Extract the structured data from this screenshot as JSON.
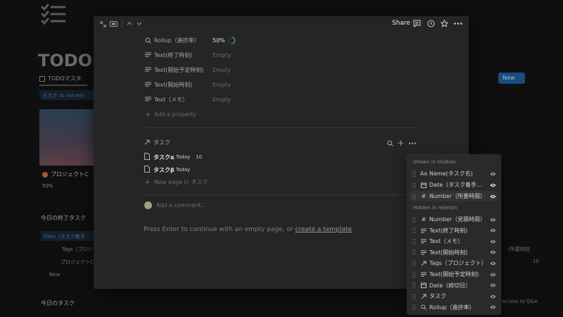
{
  "background": {
    "page_title": "TODOリ",
    "tab_label": "TODOマスタ",
    "filter_chip": "タスク: Is not em",
    "card_title": "プロジェクトC",
    "card_pct": "50%",
    "section1": "今日の終了タスク",
    "section1_link": "Date（タスク着手",
    "tags_text": "Tags（プロジ",
    "project_row": "プロジェクトC",
    "new_text": "New",
    "section2": "今日のタスク",
    "new_button": "New",
    "right_text1": "(所要時間",
    "right_text2": "10",
    "right_text3": "t access to Q&A"
  },
  "modal": {
    "share_label": "Share",
    "properties": [
      {
        "icon": "search-icon",
        "name": "Rollup（進捗率）",
        "value": "50%",
        "strong": true
      },
      {
        "icon": "text-lines-icon",
        "name": "Text(終了時刻)",
        "value": "Empty"
      },
      {
        "icon": "text-lines-icon",
        "name": "Text(開始予定時刻)",
        "value": "Empty"
      },
      {
        "icon": "text-lines-icon",
        "name": "Text(開始時刻)",
        "value": "Empty"
      },
      {
        "icon": "text-lines-icon",
        "name": "Text（メモ）",
        "value": "Empty"
      }
    ],
    "add_property": "Add a property",
    "relation_title": "タスク",
    "tasks": [
      {
        "name": "タスクα",
        "date": "Today",
        "num": "10"
      },
      {
        "name": "タスクβ",
        "date": "Today",
        "num": ""
      }
    ],
    "new_page": "New page in タスク",
    "comment_placeholder": "Add a comment...",
    "enter_text": "Press Enter to continue with an empty page, or ",
    "enter_link": "create a template",
    "progress_fraction": 0.5
  },
  "popup": {
    "shown_heading": "Shown in relation",
    "hidden_heading": "Hidden in relation",
    "shown": [
      {
        "icon": "Aa",
        "label": "Name(タスク名)",
        "visible": true
      },
      {
        "icon": "calendar",
        "label": "Date（タスク着手日）",
        "visible": true
      },
      {
        "icon": "#",
        "label": "Number（所要時間）",
        "visible": true,
        "active": true
      }
    ],
    "hidden": [
      {
        "icon": "#",
        "label": "Number（見積時間）"
      },
      {
        "icon": "lines",
        "label": "Text(終了時刻)"
      },
      {
        "icon": "lines",
        "label": "Text（メモ）"
      },
      {
        "icon": "lines",
        "label": "Text(開始時刻)"
      },
      {
        "icon": "arrow",
        "label": "Tags（プロジェクト）"
      },
      {
        "icon": "lines",
        "label": "Text(開始予定時刻)"
      },
      {
        "icon": "calendar",
        "label": "Date（締切日）"
      },
      {
        "icon": "arrow",
        "label": "タスク"
      },
      {
        "icon": "search",
        "label": "Rollup（進捗率）"
      }
    ]
  }
}
